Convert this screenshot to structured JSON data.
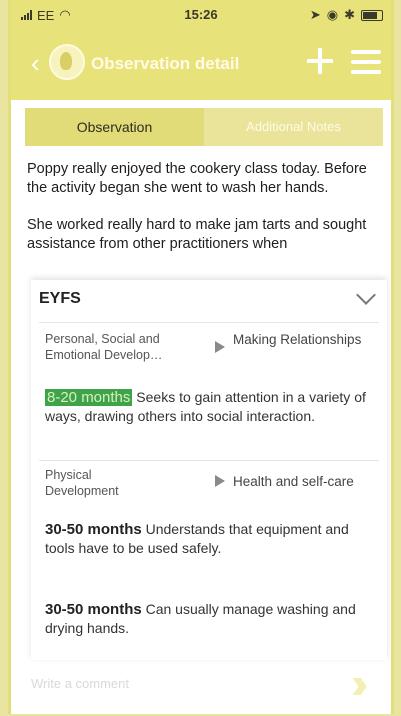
{
  "status_bar": {
    "carrier": "EE",
    "time": "15:26"
  },
  "nav": {
    "title": "Observation detail",
    "icons": [
      "back-icon",
      "logo-icon",
      "plus-icon",
      "menu-icon"
    ]
  },
  "tabs": [
    {
      "label": "Observation",
      "active": true
    },
    {
      "label": "Additional Notes",
      "active": false
    }
  ],
  "observation": {
    "paragraphs": [
      "Poppy really enjoyed the cookery class today. Before the activity began she went to wash her hands.",
      "She worked really hard to make jam tarts and sought assistance from other practitioners when"
    ]
  },
  "eyfs": {
    "heading": "EYFS",
    "groups": [
      {
        "area": "Personal, Social and Emotional Develop…",
        "aspect": "Making Relationships",
        "statements": [
          {
            "age": "8-20 months",
            "text": "Seeks to gain attention in a variety of ways, drawing others into social interaction.",
            "highlighted": true
          }
        ]
      },
      {
        "area": "Physical Development",
        "aspect": "Health and self-care",
        "statements": [
          {
            "age": "30-50 months",
            "text": "Understands that equipment and tools have to be used safely.",
            "highlighted": false
          },
          {
            "age": "30-50 months",
            "text": "Can usually manage washing and drying hands.",
            "highlighted": false
          }
        ]
      }
    ]
  },
  "comment": {
    "placeholder": "Write a comment"
  },
  "colors": {
    "brand": "#e7e27a",
    "highlight": "#3fa34a"
  }
}
